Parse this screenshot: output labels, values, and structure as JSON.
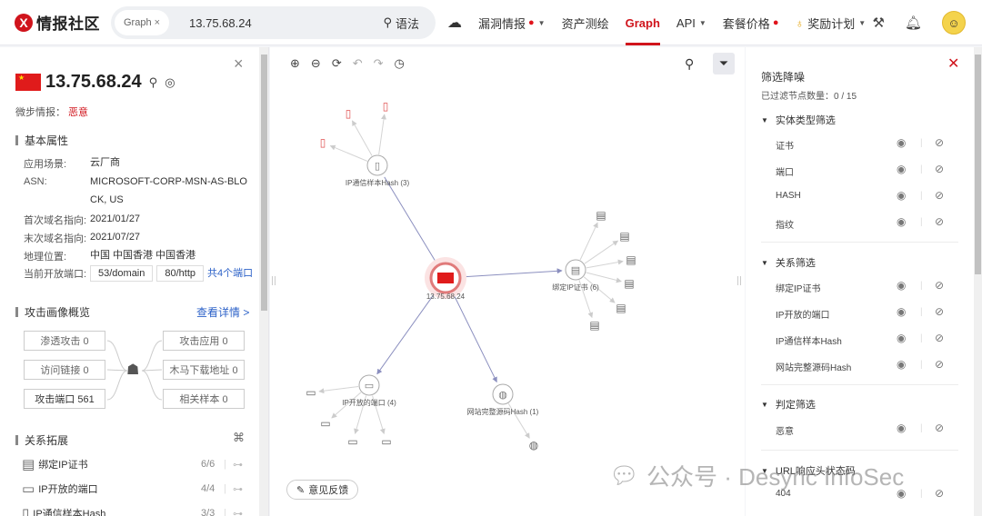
{
  "header": {
    "logo_mark": "X",
    "logo_text": "情报社区",
    "search_chip": "Graph",
    "search_chip_close": "×",
    "search_value": "13.75.68.24",
    "syntax_label": "语法",
    "nav": [
      {
        "label": "漏洞情报",
        "fire": true,
        "caret": true,
        "active": false
      },
      {
        "label": "资产测绘",
        "fire": false,
        "caret": false,
        "active": false
      },
      {
        "label": "Graph",
        "fire": false,
        "caret": false,
        "active": true
      },
      {
        "label": "API",
        "fire": false,
        "caret": true,
        "active": false
      },
      {
        "label": "套餐价格",
        "fire": true,
        "caret": false,
        "active": false
      },
      {
        "label": "奖励计划",
        "fire": false,
        "caret": true,
        "active": false
      }
    ],
    "accent_color": "#d0141c"
  },
  "left": {
    "ip": "13.75.68.24",
    "micro_label": "微步情报：",
    "micro_value": "恶意",
    "basic_title": "基本属性",
    "attrs": [
      {
        "k": "应用场景:",
        "v": "云厂商"
      },
      {
        "k": "ASN:",
        "v": "MICROSOFT-CORP-MSN-AS-BLOCK, US"
      },
      {
        "k": "首次域名指向:",
        "v": "2021/01/27"
      },
      {
        "k": "末次域名指向:",
        "v": "2021/07/27"
      },
      {
        "k": "地理位置:",
        "v": "中国 中国香港 中国香港"
      }
    ],
    "ports_label": "当前开放端口:",
    "ports": [
      "53/domain",
      "80/http"
    ],
    "ports_more": "共4个端口",
    "attack_title": "攻击画像概览",
    "attack_link": "查看详情 >",
    "attack_left": [
      "渗透攻击 0",
      "访问链接 0",
      "攻击端口 561"
    ],
    "attack_right": [
      "攻击应用 0",
      "木马下载地址 0",
      "相关样本 0"
    ],
    "relation_title": "关系拓展",
    "relations": [
      {
        "label": "绑定IP证书",
        "count": "6/6"
      },
      {
        "label": "IP开放的端口",
        "count": "4/4"
      },
      {
        "label": "IP通信样本Hash",
        "count": "3/3"
      }
    ]
  },
  "graph": {
    "center_label": "13.75.68.24",
    "groups": [
      {
        "label": "IP通信样本Hash (3)",
        "children": 3
      },
      {
        "label": "绑定IP证书 (6)",
        "children": 6
      },
      {
        "label": "IP开放的端口 (4)",
        "children": 4
      },
      {
        "label": "网站完整源码Hash (1)",
        "children": 1
      }
    ],
    "feedback_label": "意见反馈"
  },
  "filter": {
    "title": "筛选降噪",
    "count": "已过滤节点数量：0 / 15",
    "groups": [
      {
        "title": "实体类型筛选",
        "items": [
          "证书",
          "端口",
          "HASH",
          "指纹"
        ]
      },
      {
        "title": "关系筛选",
        "items": [
          "绑定IP证书",
          "IP开放的端口",
          "IP通信样本Hash",
          "网站完整源码Hash"
        ]
      },
      {
        "title": "判定筛选",
        "items": [
          "恶意"
        ]
      },
      {
        "title": "URL响应头状态码",
        "items": [
          "404"
        ]
      }
    ]
  },
  "watermark": "公众号 · Desync InfoSec"
}
